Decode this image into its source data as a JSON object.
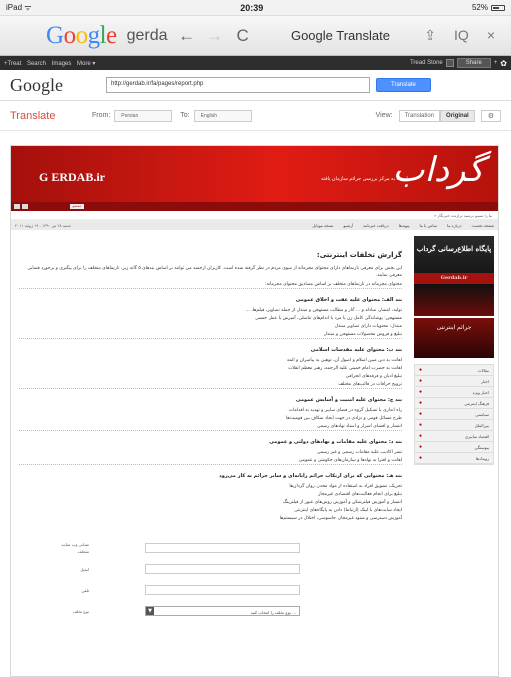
{
  "status": {
    "device": "iPad ᯤ",
    "time": "20:39",
    "battery": "52%"
  },
  "chrome": {
    "tab_logo": "Google",
    "tab_text": "gerda",
    "back": "←",
    "forward": "→",
    "reload": "C",
    "title": "Google Translate",
    "share_icon": "⇪",
    "tabs_icon": "IQ",
    "close_icon": "×"
  },
  "gbar": {
    "links": [
      "+Treat",
      "Search",
      "Images",
      "More ▾"
    ],
    "right_label": "Tread Stone",
    "share": "Share",
    "plus": "+",
    "gear": "✿"
  },
  "translate_header": {
    "logo": "Google",
    "url": "http://gerdab.ir/fa/pages/report.php",
    "button": "Translate"
  },
  "translate_bar": {
    "label": "Translate",
    "from_label": "From:",
    "from_value": "Persian",
    "to_label": "To:",
    "to_value": "English",
    "view_label": "View:",
    "view_translation": "Translation",
    "view_original": "Original",
    "gear": "⚙"
  },
  "site": {
    "brand": "G ERDAB.ir",
    "tagline": "وابسته به مرکز بررسی جرائم سازمان یافته",
    "calligraphy": "گرداب",
    "search_mini": "جستجو",
    "breadcrumbs": "» ما را نسیم برسید ترازنده خبرنگار",
    "date": "شنبه ۲۸ تیر ۱۳۹۰ - ۱۹ ژوئیه ۲۰۱۱",
    "nav": [
      "صفحه نخست",
      "درباره ما",
      "تماس با ما",
      "پیوندها",
      "دریافت خبرنامه",
      "آرشیو",
      "نسخه موبایل"
    ],
    "page_title": "گزارش تخلفات اینترنتی:",
    "intro": "این بخش برای معرفی تارنماهای دارای محتوای مجرمانه از سوی مردم در نظر گرفته شده است. کاربران ارجمند می توانند بر اساس بندهای ۵ گانه زیر، تارنماهای متخلف را برای پیگیری و برخورد قضایی معرفی نمایند.",
    "intro2": "محتوای مجرمانه در تارنماهای متخلف بر اساس مصادیق محتوای مجرمانه:",
    "sections": [
      {
        "head": "بند الف: محتوای علیه عفت و اخلاق عمومی",
        "items": [
          "تولید، انتشار، مبادله و ... آثار و مطالب مستهجن و مبتذل از جمله تصاویر، فیلم‌ها، ...",
          "مستهجن: پوشاندگی کامل زن یا مرد یا اندام‌های تناسلی، آمیزش یا عمل جنسی",
          "مبتذل: محتویات دارای تصاویر مبتذل",
          "تبلیغ و فروش محصولات مستهجن و مبتذل"
        ]
      },
      {
        "head": "بند ب: محتوای علیه مقدسات اسلامی",
        "items": [
          "اهانت به دین مبین اسلام و اصول آن، توهین به پیامبران و ائمه",
          "اهانت به حضرت امام خمینی علیه الرحمه، رهبر معظم انقلاب",
          "تبلیغ ادیان و فرقه‌های انحرافی",
          "ترویج خرافات در قالب‌های مختلف"
        ]
      },
      {
        "head": "بند ج: محتوای علیه امنیت و آسایش عمومی",
        "items": [
          "راه اندازی یا تشکیل گروه در فضای سایبر و تهدید به اقدامات",
          "طرح مسائل قومی و نژادی در جهت ایجاد شکاف بین قومیت‌ها",
          "انتشار و افشای اسرار و اسناد نهادهای رسمی"
        ]
      },
      {
        "head": "بند د: محتوای علیه مقامات و نهادهای دولتی و عمومی",
        "items": [
          "نشر اکاذیب علیه مقامات رسمی و غیر رسمی",
          "اهانت و افترا به نهادها و سازمان‌های حکومتی و عمومی"
        ]
      },
      {
        "head": "بند هـ: محتوایی که برای ارتکاب جرائم رایانه‌ای و سایر جرائم به کار می‌رود",
        "items": [
          "تحریک، تشویق افراد به استفاده از مواد مخدر، روان گردان‌ها",
          "تبلیغ برای انجام فعالیت‌های اقتصادی غیرمجاز",
          "انتشار و آموزش فیلترشکن و آموزش روش‌های عبور از فیلترینگ",
          "ایجاد سایت‌های با لینک (ارتباط) دادن به پایگاه‌های اینترنتی",
          "آموزش دسترسی و شنود غیرمجاز، جاسوسی، اختلال در سیستم‌ها"
        ]
      }
    ],
    "form": [
      {
        "label": "نشانی وب سایت متخلف"
      },
      {
        "label": "ایمیل"
      },
      {
        "label": "تلفن"
      }
    ],
    "form_select_label": "نوع تخلف",
    "form_select_value": "... نوع تخلف را انتخاب کنید",
    "promo_title": "پایگاه اطلاع‌رسانی گرداب",
    "promo_sub": "Gerdab.ir",
    "promo2": "جرائم اینترنتی",
    "side_menu": [
      "مقالات",
      "اخبار",
      "اخبار ویژه",
      "فرهنگ اینترنتی",
      "سیاستی",
      "بین‌الملل",
      "اقتصاد سایبری",
      "پیوستگی",
      "رویدادها"
    ]
  }
}
